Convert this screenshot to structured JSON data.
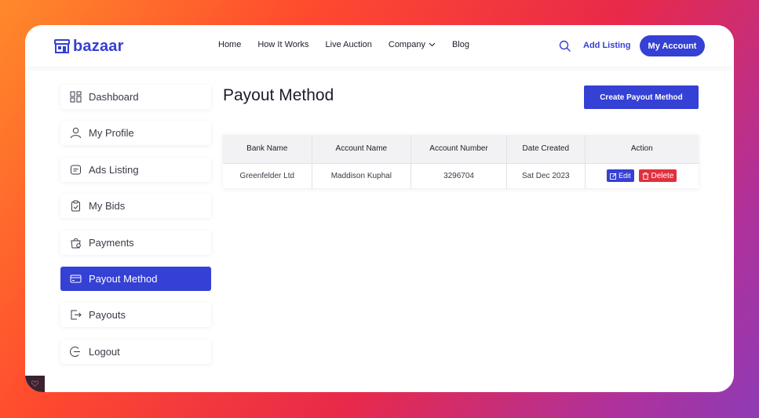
{
  "brand": {
    "name": "bazaar",
    "color": "#3540d4"
  },
  "nav": {
    "items": [
      {
        "label": "Home"
      },
      {
        "label": "How It Works"
      },
      {
        "label": "Live Auction"
      },
      {
        "label": "Company",
        "has_dropdown": true
      },
      {
        "label": "Blog"
      }
    ],
    "add_listing": "Add Listing",
    "account_button": "My Account"
  },
  "sidebar": {
    "items": [
      {
        "label": "Dashboard",
        "icon": "dashboard-icon"
      },
      {
        "label": "My Profile",
        "icon": "user-icon"
      },
      {
        "label": "Ads Listing",
        "icon": "ads-icon"
      },
      {
        "label": "My Bids",
        "icon": "clipboard-icon"
      },
      {
        "label": "Payments",
        "icon": "bag-icon"
      },
      {
        "label": "Payout Method",
        "icon": "card-icon",
        "active": true
      },
      {
        "label": "Payouts",
        "icon": "export-icon"
      },
      {
        "label": "Logout",
        "icon": "logout-icon"
      }
    ]
  },
  "main": {
    "title": "Payout Method",
    "create_button": "Create Payout Method",
    "table": {
      "columns": [
        "Bank Name",
        "Account Name",
        "Account Number",
        "Date Created",
        "Action"
      ],
      "rows": [
        {
          "bank_name": "Greenfelder Ltd",
          "account_name": "Maddison Kuphal",
          "account_number": "3296704",
          "date_created": "Sat Dec 2023",
          "edit_label": "Edit",
          "delete_label": "Delete"
        }
      ]
    }
  },
  "colors": {
    "primary": "#3540d4",
    "danger": "#e0303f"
  }
}
